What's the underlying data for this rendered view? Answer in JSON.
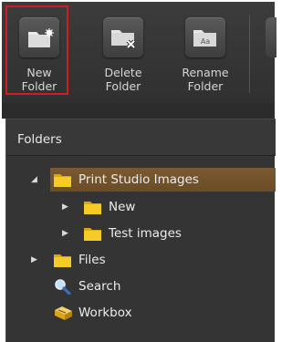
{
  "toolbar": {
    "new_folder": {
      "label": "New\nFolder",
      "icon": "new-folder-icon"
    },
    "delete_folder": {
      "label": "Delete\nFolder",
      "icon": "delete-folder-icon"
    },
    "rename_folder": {
      "label": "Rename\nFolder",
      "icon": "rename-folder-icon",
      "icon_text": "Aa"
    }
  },
  "panel": {
    "title": "Folders"
  },
  "tree": {
    "items": [
      {
        "label": "Print Studio Images",
        "icon": "folder-icon",
        "expanded": true,
        "selected": true
      },
      {
        "label": "New",
        "icon": "folder-icon",
        "expanded": false
      },
      {
        "label": "Test images",
        "icon": "folder-icon",
        "expanded": false
      },
      {
        "label": "Files",
        "icon": "folder-icon",
        "expanded": false
      },
      {
        "label": "Search",
        "icon": "search-icon"
      },
      {
        "label": "Workbox",
        "icon": "workbox-icon"
      }
    ]
  },
  "colors": {
    "toolbar_bg": "#363636",
    "panel_bg": "#343434",
    "selection": "#744f28",
    "highlight_frame": "#d21d1d",
    "folder": "#f3c21c"
  }
}
